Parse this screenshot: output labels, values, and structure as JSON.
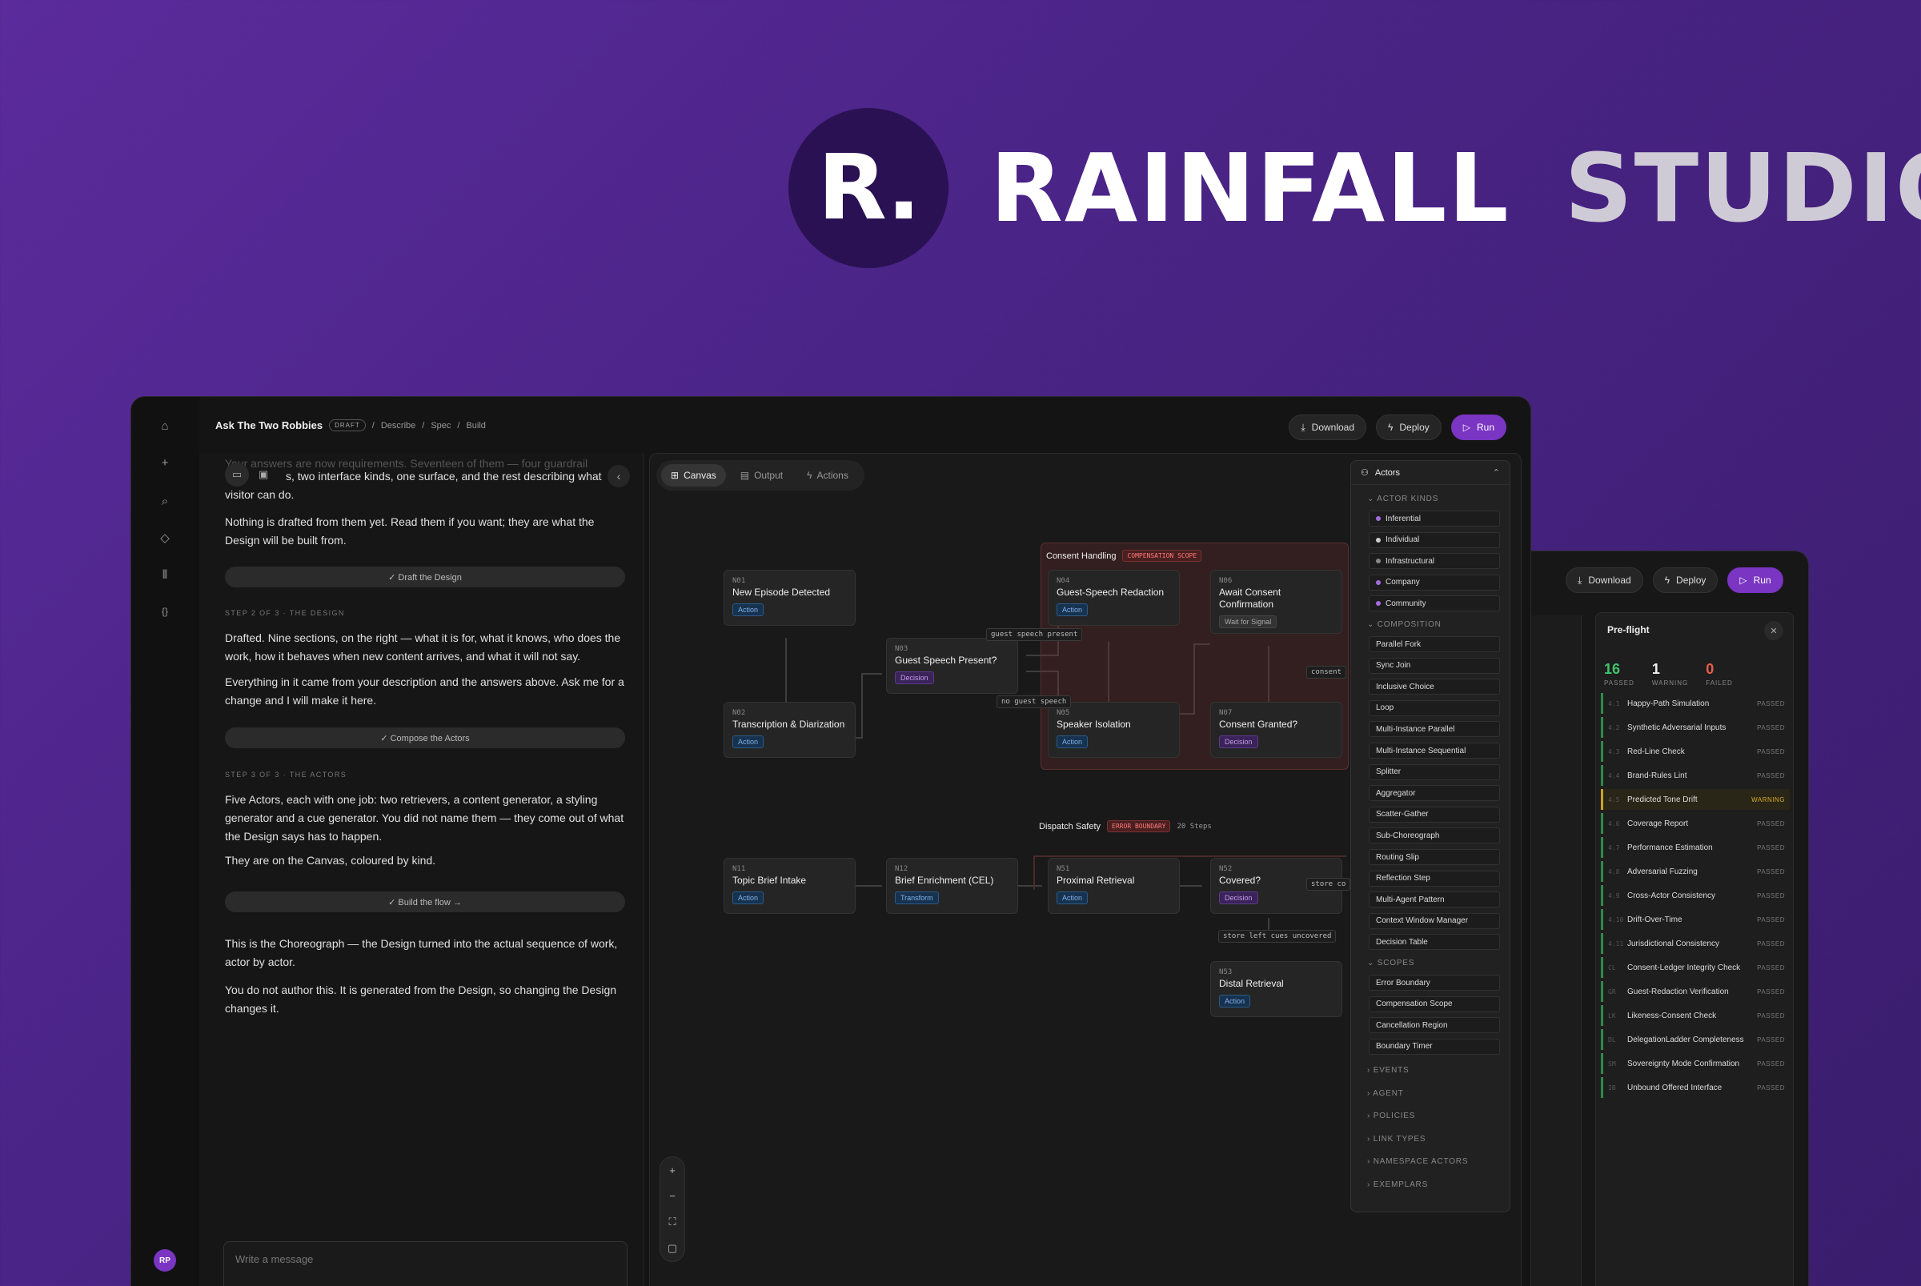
{
  "hero": {
    "initial": "R.",
    "word1": "RAINFALL",
    "word2": "STUDIO"
  },
  "header": {
    "title": "Ask The Two Robbies",
    "badge": "DRAFT",
    "crumbs": [
      "Describe",
      "Spec",
      "Build"
    ],
    "download": "Download",
    "deploy": "Deploy",
    "run": "Run"
  },
  "rail": {
    "avatar": "RP"
  },
  "chat": {
    "partial": "Your answers are now requirements. Seventeen of them — four guardrail",
    "line1b": "s, two interface kinds, one surface, and the rest describing what",
    "line1c": "visitor can do.",
    "p2": "Nothing is drafted from them yet. Read them if you want; they are what the Design will be built from.",
    "pill1": "✓ Draft the Design",
    "step2": "STEP 2 OF 3 · THE DESIGN",
    "p3": "Drafted. Nine sections, on the right — what it is for, what it knows, who does the work, how it behaves when new content arrives, and what it will not say.",
    "p4": "Everything in it came from your description and the answers above. Ask me for a change and I will make it here.",
    "pill2": "✓ Compose the Actors",
    "step3": "STEP 3 OF 3 · THE ACTORS",
    "p5": "Five Actors, each with one job: two retrievers, a content generator, a styling generator and a cue generator. You did not name them — they come out of what the Design says has to happen.",
    "p6": "They are on the Canvas, coloured by kind.",
    "pill3": "✓ Build the flow →",
    "p7": "This is the Choreograph — the Design turned into the actual sequence of work, actor by actor.",
    "p8": "You do not author this. It is generated from the Design, so changing the Design changes it.",
    "placeholder": "Write a message"
  },
  "canvas": {
    "tabs": [
      "Canvas",
      "Output",
      "Actions"
    ],
    "scope1": {
      "label": "Consent Handling",
      "tag": "COMPENSATION SCOPE"
    },
    "scope2": {
      "label": "Dispatch Safety",
      "tag": "ERROR BOUNDARY",
      "extra": "20 Steps"
    },
    "nodes": {
      "n01": {
        "id": "N01",
        "name": "New Episode Detected",
        "tag": "Action"
      },
      "n02": {
        "id": "N02",
        "name": "Transcription & Diarization",
        "tag": "Action"
      },
      "n03": {
        "id": "N03",
        "name": "Guest Speech Present?",
        "tag": "Decision"
      },
      "n04": {
        "id": "N04",
        "name": "Guest-Speech Redaction",
        "tag": "Action"
      },
      "n05": {
        "id": "N05",
        "name": "Speaker Isolation",
        "tag": "Action"
      },
      "n06": {
        "id": "N06",
        "name": "Await Consent Confirmation",
        "tag": "Wait for Signal"
      },
      "n07": {
        "id": "N07",
        "name": "Consent Granted?",
        "tag": "Decision"
      },
      "n11": {
        "id": "N11",
        "name": "Topic Brief Intake",
        "tag": "Action"
      },
      "n12": {
        "id": "N12",
        "name": "Brief Enrichment (CEL)",
        "tag": "Transform"
      },
      "n51": {
        "id": "N51",
        "name": "Proximal Retrieval",
        "tag": "Action"
      },
      "n52": {
        "id": "N52",
        "name": "Covered?",
        "tag": "Decision"
      },
      "n53": {
        "id": "N53",
        "name": "Distal Retrieval",
        "tag": "Action"
      }
    },
    "edges": {
      "present": "guest speech present",
      "none": "no guest speech",
      "consent": "consent",
      "storeco": "store co",
      "uncovered": "store left cues uncovered"
    }
  },
  "actors": {
    "title": "Actors",
    "kinds_label": "ACTOR KINDS",
    "kinds": [
      {
        "name": "Inferential",
        "color": "#a56be0"
      },
      {
        "name": "Individual",
        "color": "#cccccc"
      },
      {
        "name": "Infrastructural",
        "color": "#888888"
      },
      {
        "name": "Company",
        "color": "#a56be0"
      },
      {
        "name": "Community",
        "color": "#a56be0"
      }
    ],
    "composition_label": "COMPOSITION",
    "composition": [
      "Parallel Fork",
      "Sync Join",
      "Inclusive Choice",
      "Loop",
      "Multi-Instance Parallel",
      "Multi-Instance Sequential",
      "Splitter",
      "Aggregator",
      "Scatter-Gather",
      "Sub-Choreograph",
      "Routing Slip",
      "Reflection Step",
      "Multi-Agent Pattern",
      "Context Window Manager",
      "Decision Table"
    ],
    "scopes_label": "SCOPES",
    "scopes": [
      "Error Boundary",
      "Compensation Scope",
      "Cancellation Region",
      "Boundary Timer"
    ],
    "collapsed": [
      "EVENTS",
      "AGENT",
      "POLICIES",
      "LINK TYPES",
      "NAMESPACE ACTORS",
      "EXEMPLARS"
    ]
  },
  "preflight": {
    "title": "Pre-flight",
    "passed": "16",
    "passed_label": "PASSED",
    "warning": "1",
    "warning_label": "WARNING",
    "failed": "0",
    "failed_label": "FAILED",
    "checks": [
      {
        "id": "4.1",
        "name": "Happy-Path Simulation",
        "status": "PASSED"
      },
      {
        "id": "4.2",
        "name": "Synthetic Adversarial Inputs",
        "status": "PASSED"
      },
      {
        "id": "4.3",
        "name": "Red-Line Check",
        "status": "PASSED"
      },
      {
        "id": "4.4",
        "name": "Brand-Rules Lint",
        "status": "PASSED"
      },
      {
        "id": "4.5",
        "name": "Predicted Tone Drift",
        "status": "WARNING"
      },
      {
        "id": "4.6",
        "name": "Coverage Report",
        "status": "PASSED"
      },
      {
        "id": "4.7",
        "name": "Performance Estimation",
        "status": "PASSED"
      },
      {
        "id": "4.8",
        "name": "Adversarial Fuzzing",
        "status": "PASSED"
      },
      {
        "id": "4.9",
        "name": "Cross-Actor Consistency",
        "status": "PASSED"
      },
      {
        "id": "4.10",
        "name": "Drift-Over-Time",
        "status": "PASSED"
      },
      {
        "id": "4.11",
        "name": "Jurisdictional Consistency",
        "status": "PASSED"
      },
      {
        "id": "CL",
        "name": "Consent-Ledger Integrity Check",
        "status": "PASSED"
      },
      {
        "id": "GR",
        "name": "Guest-Redaction Verification",
        "status": "PASSED"
      },
      {
        "id": "LK",
        "name": "Likeness-Consent Check",
        "status": "PASSED"
      },
      {
        "id": "DL",
        "name": "DelegationLadder Completeness",
        "status": "PASSED"
      },
      {
        "id": "SM",
        "name": "Sovereignty Mode Confirmation",
        "status": "PASSED"
      },
      {
        "id": "IB",
        "name": "Unbound Offered Interface",
        "status": "PASSED"
      }
    ]
  }
}
